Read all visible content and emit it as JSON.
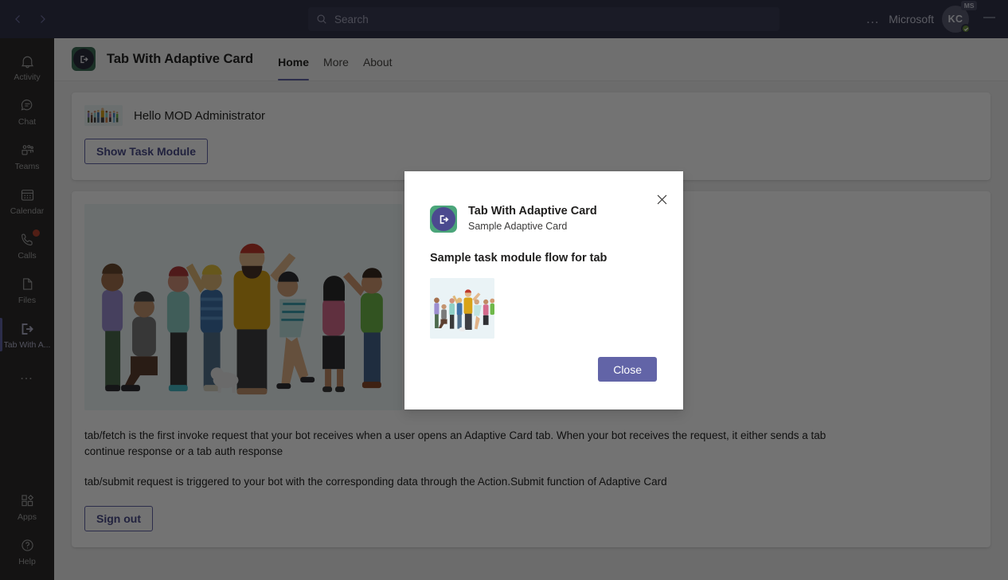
{
  "window": {
    "back_icon": "chevron-left-icon",
    "forward_icon": "chevron-right-icon",
    "minimize_label": "—"
  },
  "search": {
    "placeholder": "Search",
    "value": "",
    "icon": "search-icon"
  },
  "account": {
    "more_label": "…",
    "org_name": "Microsoft",
    "avatar_initials": "KC",
    "avatar_badge": "MS",
    "presence": "available"
  },
  "sidebar": {
    "items": [
      {
        "label": "Activity",
        "icon": "bell-icon",
        "active": false,
        "badge": false
      },
      {
        "label": "Chat",
        "icon": "chat-icon",
        "active": false,
        "badge": false
      },
      {
        "label": "Teams",
        "icon": "teams-icon",
        "active": false,
        "badge": false
      },
      {
        "label": "Calendar",
        "icon": "calendar-icon",
        "active": false,
        "badge": false
      },
      {
        "label": "Calls",
        "icon": "phone-icon",
        "active": false,
        "badge": true
      },
      {
        "label": "Files",
        "icon": "file-icon",
        "active": false,
        "badge": false
      },
      {
        "label": "Tab With A...",
        "icon": "exit-arrow-icon",
        "active": true,
        "badge": false
      }
    ],
    "more_label": "…",
    "bottom_items": [
      {
        "label": "Apps",
        "icon": "apps-icon"
      },
      {
        "label": "Help",
        "icon": "help-circle-icon"
      }
    ]
  },
  "app_header": {
    "icon": "exit-arrow-icon",
    "title": "Tab With Adaptive Card",
    "tabs": [
      {
        "label": "Home",
        "active": true
      },
      {
        "label": "More",
        "active": false
      },
      {
        "label": "About",
        "active": false
      }
    ]
  },
  "main": {
    "greeting": "Hello MOD Administrator",
    "greeting_thumb": "people-illustration",
    "show_task_module_label": "Show Task Module",
    "hero_image": "people-illustration",
    "paragraph_1": "tab/fetch is the first invoke request that your bot receives when a user opens an Adaptive Card tab. When your bot receives the request, it either sends a tab continue response or a tab auth response",
    "paragraph_2": "tab/submit request is triggered to your bot with the corresponding data through the Action.Submit function of Adaptive Card",
    "sign_out_label": "Sign out"
  },
  "dialog": {
    "close_icon": "close-icon",
    "app_icon": "exit-arrow-icon",
    "title": "Tab With Adaptive Card",
    "subtitle": "Sample Adaptive Card",
    "heading": "Sample task module flow for tab",
    "image": "people-illustration",
    "primary_button_label": "Close"
  },
  "colors": {
    "brand_purple": "#6264a7",
    "topbar": "#32344a",
    "rail": "#2d2c2c",
    "content_bg": "#f0f0f0",
    "presence_green": "#6b8e3e",
    "badge_red": "#b3432f",
    "app_icon_green": "#4ba57a",
    "app_icon_circle": "#4b4a8f"
  }
}
